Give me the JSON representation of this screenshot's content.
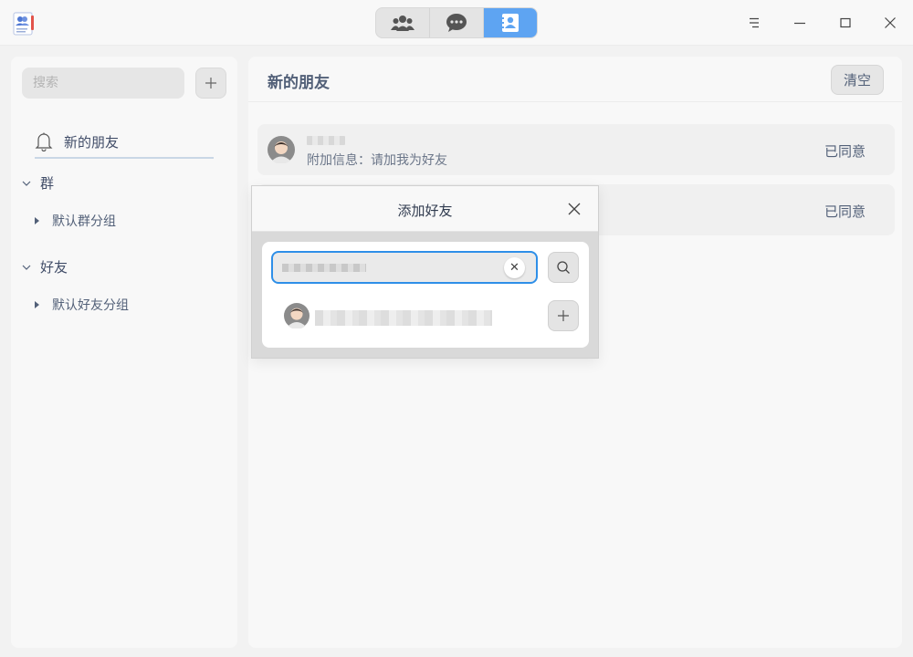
{
  "app": {
    "icon": "contacts-app-icon",
    "tabs": [
      {
        "name": "groups-tab",
        "icon": "people-icon",
        "active": false
      },
      {
        "name": "chats-tab",
        "icon": "chat-bubble-icon",
        "active": false
      },
      {
        "name": "contacts-tab",
        "icon": "contact-card-icon",
        "active": true
      }
    ],
    "accent_color": "#5ea4f2",
    "window_controls": [
      "menu-icon",
      "minimize-icon",
      "maximize-icon",
      "close-icon"
    ]
  },
  "sidebar": {
    "search_placeholder": "搜索",
    "new_friends_label": "新的朋友",
    "sections": [
      {
        "label": "群",
        "expanded": true,
        "items": [
          {
            "label": "默认群分组"
          }
        ]
      },
      {
        "label": "好友",
        "expanded": true,
        "items": [
          {
            "label": "默认好友分组"
          }
        ]
      }
    ]
  },
  "main": {
    "title": "新的朋友",
    "clear_label": "清空",
    "requests": [
      {
        "info": "附加信息：请加我为好友",
        "status": "已同意"
      },
      {
        "status": "已同意"
      }
    ]
  },
  "dialog": {
    "title": "添加好友",
    "focus_color": "#2e8fe8"
  }
}
